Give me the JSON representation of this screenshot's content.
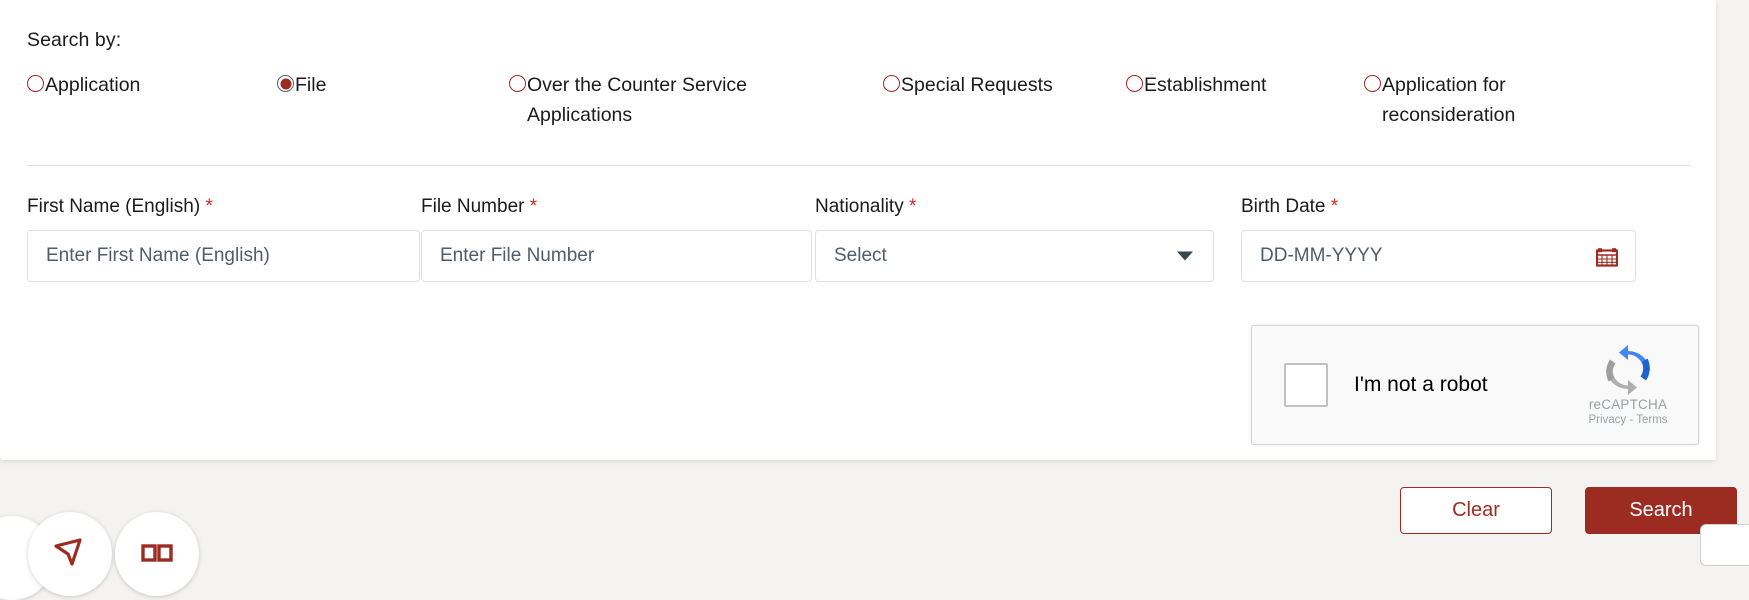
{
  "search_by": {
    "label": "Search by:",
    "options": [
      {
        "label": "Application",
        "selected": false
      },
      {
        "label": "File",
        "selected": true
      },
      {
        "label": "Over the Counter Service Applications",
        "selected": false
      },
      {
        "label": "Special Requests",
        "selected": false
      },
      {
        "label": "Establishment",
        "selected": false
      },
      {
        "label": "Application for reconsideration",
        "selected": false
      }
    ]
  },
  "fields": [
    {
      "label": "First Name (English)",
      "required_mark": "*",
      "placeholder": "Enter First Name (English)",
      "value": "",
      "type": "text"
    },
    {
      "label": "File Number",
      "required_mark": "*",
      "placeholder": "Enter File Number",
      "value": "",
      "type": "text"
    },
    {
      "label": "Nationality",
      "required_mark": "*",
      "placeholder": "Select",
      "value": "",
      "type": "select"
    },
    {
      "label": "Birth Date",
      "required_mark": "*",
      "placeholder": "DD-MM-YYYY",
      "value": "",
      "type": "date"
    }
  ],
  "recaptcha": {
    "checkbox_label": "I'm not a robot",
    "brand": "reCAPTCHA",
    "privacy": "Privacy",
    "separator": "-",
    "terms": "Terms",
    "checked": false
  },
  "actions": {
    "clear_label": "Clear",
    "search_label": "Search"
  },
  "colors": {
    "brand_maroon": "#9c2c22",
    "required_red": "#d32a20",
    "placeholder": "#4e5d6b",
    "page_background": "#f4f3f1",
    "card_background": "#ffffff",
    "caret": "#37474f"
  }
}
